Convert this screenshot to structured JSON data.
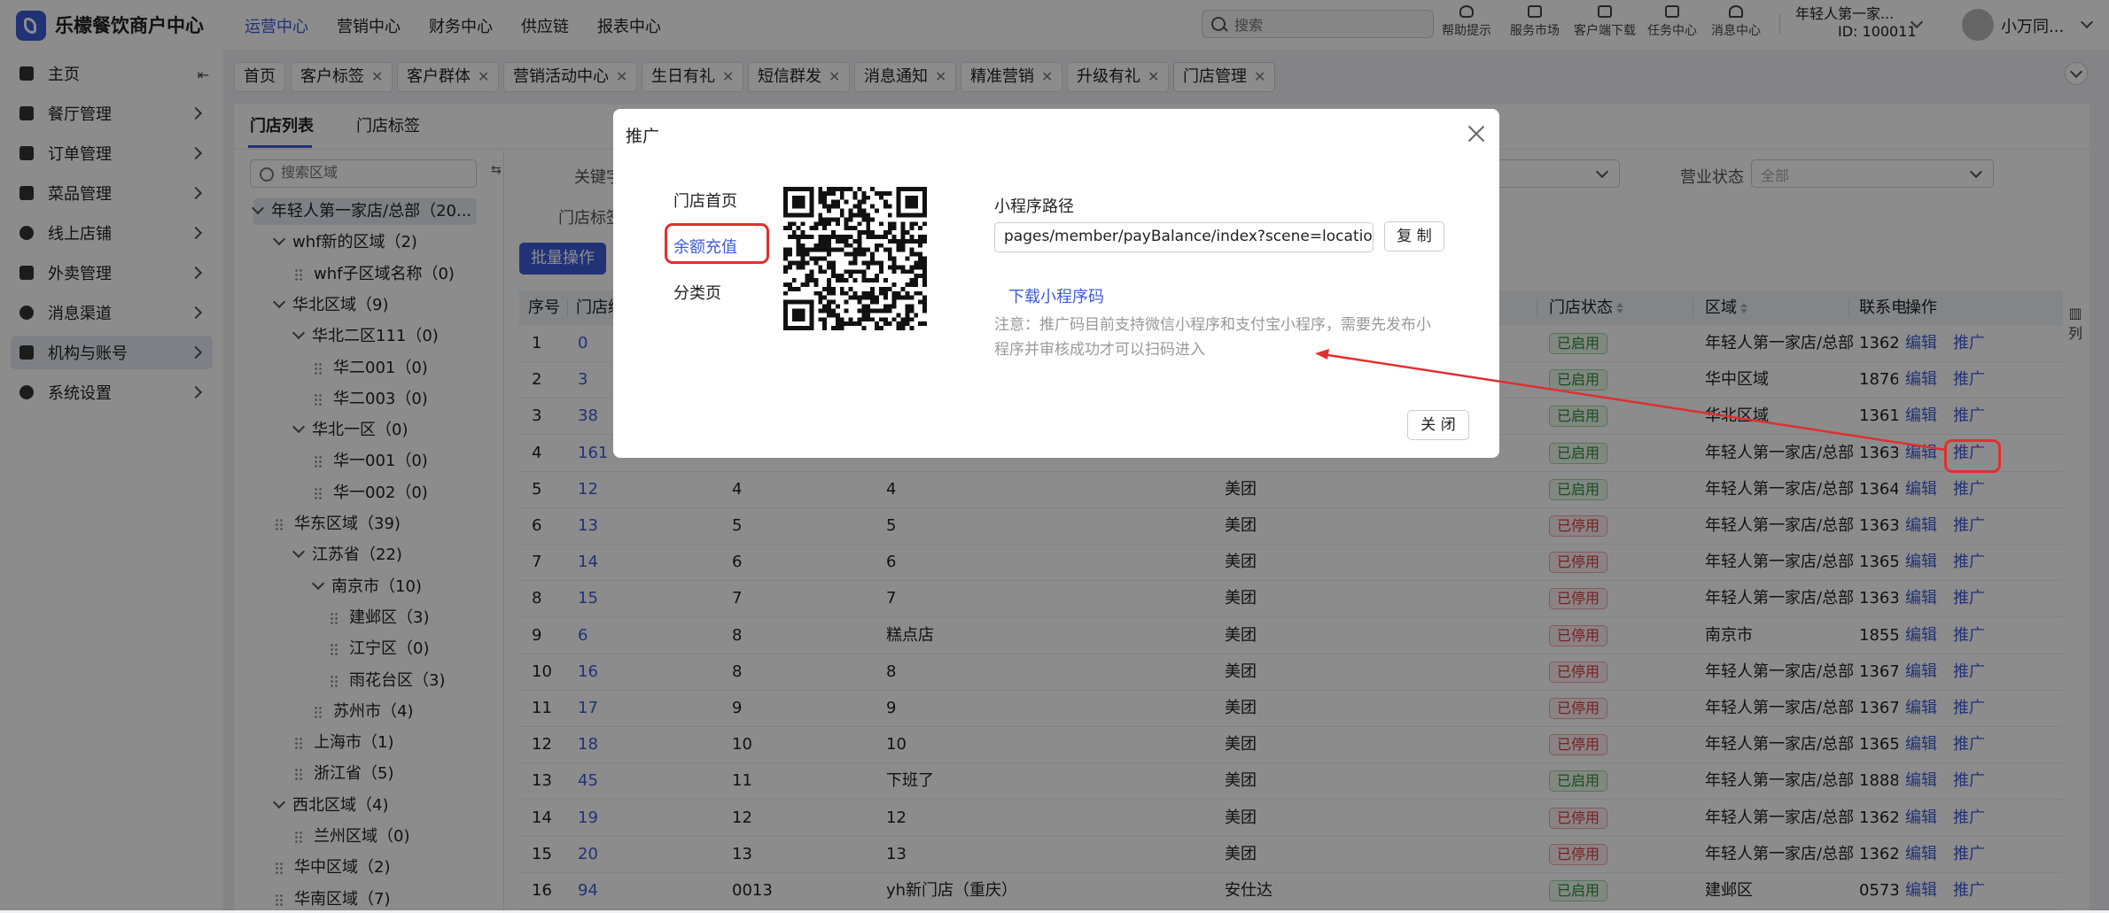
{
  "app": {
    "brand": "乐檬餐饮商户中心",
    "nav": [
      {
        "label": "运营中心",
        "active": true
      },
      {
        "label": "营销中心",
        "active": false
      },
      {
        "label": "财务中心",
        "active": false
      },
      {
        "label": "供应链",
        "active": false
      },
      {
        "label": "报表中心",
        "active": false
      }
    ],
    "search_placeholder": "搜索",
    "tools": [
      {
        "label": "帮助提示",
        "icon": "lightbulb-icon"
      },
      {
        "label": "服务市场",
        "icon": "bag-icon"
      },
      {
        "label": "客户端下载",
        "icon": "download-icon"
      },
      {
        "label": "任务中心",
        "icon": "clipboard-icon"
      },
      {
        "label": "消息中心",
        "icon": "bell-icon"
      }
    ],
    "account": {
      "name": "年轻人第一家...",
      "id": "ID: 100011"
    },
    "user": "小万同..."
  },
  "sidebar": {
    "items": [
      {
        "label": "主页",
        "icon": "home-icon"
      },
      {
        "label": "餐厅管理",
        "icon": "store-icon"
      },
      {
        "label": "订单管理",
        "icon": "order-icon"
      },
      {
        "label": "菜品管理",
        "icon": "dish-icon"
      },
      {
        "label": "线上店铺",
        "icon": "globe-icon"
      },
      {
        "label": "外卖管理",
        "icon": "bank-icon"
      },
      {
        "label": "消息渠道",
        "icon": "chat-icon"
      },
      {
        "label": "机构与账号",
        "icon": "org-icon"
      },
      {
        "label": "系统设置",
        "icon": "gear-icon"
      }
    ]
  },
  "tabs": [
    "首页",
    "客户标签",
    "客户群体",
    "营销活动中心",
    "生日有礼",
    "短信群发",
    "消息通知",
    "精准营销",
    "升级有礼",
    "门店管理"
  ],
  "subtabs": [
    "门店列表",
    "门店标签"
  ],
  "area_search_placeholder": "搜索区域",
  "tree": [
    {
      "label": "年轻人第一家店/总部（20...",
      "level": 0,
      "kind": "arrow"
    },
    {
      "label": "whf新的区域（2)",
      "level": 1,
      "kind": "arrow"
    },
    {
      "label": "whf子区域名称（0)",
      "level": 2,
      "kind": "dots"
    },
    {
      "label": "华北区域（9)",
      "level": 1,
      "kind": "arrow"
    },
    {
      "label": "华北二区111（0)",
      "level": 2,
      "kind": "arrow"
    },
    {
      "label": "华二001（0)",
      "level": 3,
      "kind": "dots"
    },
    {
      "label": "华二003（0)",
      "level": 3,
      "kind": "dots"
    },
    {
      "label": "华北一区（0)",
      "level": 2,
      "kind": "arrow"
    },
    {
      "label": "华一001（0)",
      "level": 3,
      "kind": "dots"
    },
    {
      "label": "华一002（0)",
      "level": 3,
      "kind": "dots"
    },
    {
      "label": "华东区域（39)",
      "level": 1,
      "kind": "dots"
    },
    {
      "label": "江苏省（22)",
      "level": 2,
      "kind": "arrow"
    },
    {
      "label": "南京市（10)",
      "level": 3,
      "kind": "arrow"
    },
    {
      "label": "建邺区（3)",
      "level": 4,
      "kind": "dots"
    },
    {
      "label": "江宁区（0)",
      "level": 4,
      "kind": "dots"
    },
    {
      "label": "雨花台区（3)",
      "level": 4,
      "kind": "dots"
    },
    {
      "label": "苏州市（4)",
      "level": 3,
      "kind": "dots"
    },
    {
      "label": "上海市（1)",
      "level": 2,
      "kind": "dots"
    },
    {
      "label": "浙江省（5)",
      "level": 2,
      "kind": "dots"
    },
    {
      "label": "西北区域（4)",
      "level": 1,
      "kind": "arrow"
    },
    {
      "label": "兰州区域（0)",
      "level": 2,
      "kind": "dots"
    },
    {
      "label": "华中区域（2)",
      "level": 1,
      "kind": "dots"
    },
    {
      "label": "华南区域（7)",
      "level": 1,
      "kind": "dots"
    }
  ],
  "filters": {
    "keyword_label": "关键字",
    "tag_label": "门店标签",
    "status_label": "营业状态",
    "status_value": "全部"
  },
  "batch_button": "批量操作",
  "table": {
    "headers": [
      "序号",
      "门店编",
      "门店状态",
      "区域",
      "联系电",
      "操作"
    ],
    "edit_label": "编辑",
    "promote_label": "推广",
    "rows": [
      {
        "idx": "1",
        "id": "0",
        "code": "",
        "name": "",
        "platform": "",
        "status": "已启用",
        "region": "年轻人第一家店/总部",
        "phone": "1362"
      },
      {
        "idx": "2",
        "id": "3",
        "code": "",
        "name": "",
        "platform": "",
        "status": "已启用",
        "region": "华中区域",
        "phone": "1876"
      },
      {
        "idx": "3",
        "id": "38",
        "code": "",
        "name": "",
        "platform": "",
        "status": "已启用",
        "region": "华北区域",
        "phone": "1361"
      },
      {
        "idx": "4",
        "id": "161",
        "code": "",
        "name": "",
        "platform": "",
        "status": "已启用",
        "region": "年轻人第一家店/总部",
        "phone": "1363"
      },
      {
        "idx": "5",
        "id": "12",
        "code": "4",
        "name": "4",
        "platform": "美团",
        "status": "已启用",
        "region": "年轻人第一家店/总部",
        "phone": "1364"
      },
      {
        "idx": "6",
        "id": "13",
        "code": "5",
        "name": "5",
        "platform": "美团",
        "status": "已停用",
        "region": "年轻人第一家店/总部",
        "phone": "1363"
      },
      {
        "idx": "7",
        "id": "14",
        "code": "6",
        "name": "6",
        "platform": "美团",
        "status": "已停用",
        "region": "年轻人第一家店/总部",
        "phone": "1365"
      },
      {
        "idx": "8",
        "id": "15",
        "code": "7",
        "name": "7",
        "platform": "美团",
        "status": "已停用",
        "region": "年轻人第一家店/总部",
        "phone": "1363"
      },
      {
        "idx": "9",
        "id": "6",
        "code": "8",
        "name": "糕点店",
        "platform": "美团",
        "status": "已停用",
        "region": "南京市",
        "phone": "1855"
      },
      {
        "idx": "10",
        "id": "16",
        "code": "8",
        "name": "8",
        "platform": "美团",
        "status": "已停用",
        "region": "年轻人第一家店/总部",
        "phone": "1367"
      },
      {
        "idx": "11",
        "id": "17",
        "code": "9",
        "name": "9",
        "platform": "美团",
        "status": "已停用",
        "region": "年轻人第一家店/总部",
        "phone": "1367"
      },
      {
        "idx": "12",
        "id": "18",
        "code": "10",
        "name": "10",
        "platform": "美团",
        "status": "已停用",
        "region": "年轻人第一家店/总部",
        "phone": "1365"
      },
      {
        "idx": "13",
        "id": "45",
        "code": "11",
        "name": "下班了",
        "platform": "美团",
        "status": "已启用",
        "region": "年轻人第一家店/总部",
        "phone": "1888"
      },
      {
        "idx": "14",
        "id": "19",
        "code": "12",
        "name": "12",
        "platform": "美团",
        "status": "已停用",
        "region": "年轻人第一家店/总部",
        "phone": "1362"
      },
      {
        "idx": "15",
        "id": "20",
        "code": "13",
        "name": "13",
        "platform": "美团",
        "status": "已停用",
        "region": "年轻人第一家店/总部",
        "phone": "1362"
      },
      {
        "idx": "16",
        "id": "94",
        "code": "0013",
        "name": "yh新门店（重庆）",
        "platform": "安仕达",
        "status": "已启用",
        "region": "建邺区",
        "phone": "0573"
      }
    ]
  },
  "column_settings_label": "列",
  "modal": {
    "title": "推广",
    "menu": [
      "门店首页",
      "余额充值",
      "分类页"
    ],
    "active_menu": "余额充值",
    "path_label": "小程序路径",
    "path_value": "pages/member/payBalance/index?scene=location_",
    "copy_label": "复 制",
    "download_label": "下载小程序码",
    "note": "注意：推广码目前支持微信小程序和支付宝小程序，需要先发布小程序并审核成功才可以扫码进入",
    "close_label": "关 闭"
  },
  "colors": {
    "accent": "#3d5bd9",
    "annotation": "#e02f2f",
    "enabled": "#2e8b3a",
    "disabled": "#d9363e"
  }
}
